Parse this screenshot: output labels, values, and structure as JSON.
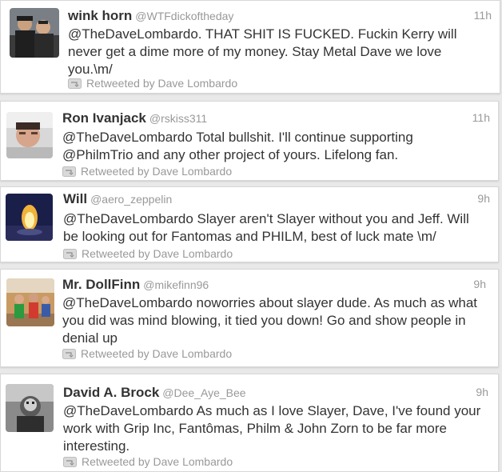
{
  "tweets": [
    {
      "name": "wink horn",
      "handle": "@WTFdickoftheday",
      "time": "11h",
      "text": "@TheDaveLombardo. THAT SHIT IS FUCKED. Fuckin Kerry will never get a dime more of my money. Stay Metal Dave we love you.\\m/",
      "retweet": "Retweeted by Dave Lombardo"
    },
    {
      "name": "Ron Ivanjack",
      "handle": "@rskiss311",
      "time": "11h",
      "text": "@TheDaveLombardo Total bullshit. I'll continue supporting @PhilmTrio and any other project of yours. Lifelong fan.",
      "retweet": "Retweeted by Dave Lombardo"
    },
    {
      "name": "Will",
      "handle": "@aero_zeppelin",
      "time": "9h",
      "text": "@TheDaveLombardo Slayer aren't Slayer without you and Jeff. Will be looking out for Fantomas and PHILM, best of luck mate \\m/",
      "retweet": "Retweeted by Dave Lombardo"
    },
    {
      "name": "Mr. DollFinn",
      "handle": "@mikefinn96",
      "time": "9h",
      "text": "@TheDaveLombardo noworries about slayer dude. As much as what you did was mind blowing, it tied you down! Go and show people in denial up",
      "retweet": "Retweeted by Dave Lombardo"
    },
    {
      "name": "David A. Brock",
      "handle": "@Dee_Aye_Bee",
      "time": "9h",
      "text": "@TheDaveLombardo As much as I love Slayer, Dave, I've found your work with Grip Inc, Fantômas, Philm & John Zorn to be far more interesting.",
      "retweet": "Retweeted by Dave Lombardo"
    }
  ]
}
